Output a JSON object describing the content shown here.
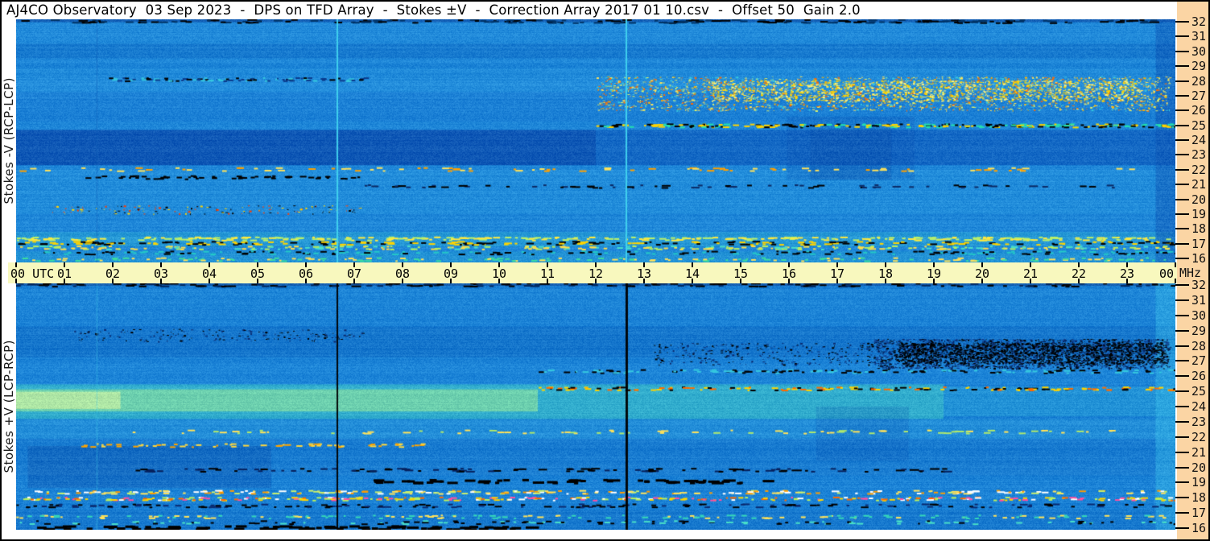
{
  "window": {
    "border_color": "#000000",
    "background": "#ffffff"
  },
  "title_bar": {
    "text": "AJ4CO Observatory  03 Sep 2023  -  DPS on TFD Array  -  Stokes ±V  -  Correction Array 2017 01 10.csv  -  Offset 50  Gain 2.0"
  },
  "time_axis": {
    "background": "#F8F8BE",
    "start_label": "00 UTC",
    "hour_labels": [
      "01",
      "02",
      "03",
      "04",
      "05",
      "06",
      "07",
      "08",
      "09",
      "10",
      "11",
      "12",
      "13",
      "14",
      "15",
      "16",
      "17",
      "18",
      "19",
      "20",
      "21",
      "22",
      "23"
    ],
    "end_label": "00",
    "unit_label": "MHz"
  },
  "freq_axis": {
    "strip_background": "#FBD5A4",
    "labels": [
      "32",
      "31",
      "30",
      "29",
      "28",
      "27",
      "26",
      "25",
      "24",
      "23",
      "22",
      "21",
      "20",
      "19",
      "18",
      "17",
      "16"
    ]
  },
  "panels": [
    {
      "id": "top",
      "side_label": "Stokes -V (RCP-LCP)",
      "render": {
        "seed": 11,
        "base": "#1E86D8",
        "bands": [
          {
            "y0": 0.0,
            "y1": 0.012,
            "color": "#0b3f9a",
            "a": 0.55
          },
          {
            "y0": 0.012,
            "y1": 0.1,
            "color": "#2591de",
            "a": 0.45
          },
          {
            "y0": 0.1,
            "y1": 0.16,
            "color": "#1570c8",
            "a": 0.4
          },
          {
            "y0": 0.2,
            "y1": 0.3,
            "color": "#2d9ce2",
            "a": 0.3
          },
          {
            "y0": 0.3,
            "y1": 0.42,
            "color": "#1a78cf",
            "a": 0.3
          },
          {
            "y0": 0.455,
            "y1": 0.6,
            "color": "#0a4cb2",
            "a": 0.5
          },
          {
            "x0": 0.0,
            "x1": 0.5,
            "y0": 0.455,
            "y1": 0.6,
            "color": "#083f9f",
            "a": 0.4
          },
          {
            "y0": 0.62,
            "y1": 0.8,
            "color": "#2f9fe0",
            "a": 0.3
          },
          {
            "y0": 0.875,
            "y1": 0.935,
            "color": "#31b7d8",
            "a": 0.4
          },
          {
            "y0": 0.955,
            "y1": 1.0,
            "color": "#2ba8d4",
            "a": 0.35
          },
          {
            "x0": 0.665,
            "x1": 0.775,
            "y0": 0.4,
            "y1": 0.66,
            "color": "#0d55b2",
            "a": 0.25
          },
          {
            "x0": 0.685,
            "x1": 0.755,
            "y0": 0.45,
            "y1": 0.66,
            "color": "#0a4aa4",
            "a": 0.25
          },
          {
            "x0": 0.983,
            "x1": 1.0,
            "y0": 0.0,
            "y1": 1.0,
            "color": "#0f57b5",
            "a": 0.5
          }
        ],
        "speckles": [
          {
            "x0": 0.5,
            "x1": 0.995,
            "y0": 0.235,
            "y1": 0.375,
            "colors": [
              "#ffe25a",
              "#ffb300",
              "#d9f06e",
              "#ff6a00",
              "#35c8e0"
            ],
            "n": 2400
          },
          {
            "x0": 0.6,
            "x1": 0.97,
            "y0": 0.25,
            "y1": 0.335,
            "colors": [
              "#ffd400",
              "#fff27a"
            ],
            "n": 1600
          },
          {
            "x0": 0.03,
            "x1": 0.3,
            "y0": 0.765,
            "y1": 0.8,
            "colors": [
              "#000000",
              "#ff3b00",
              "#ffd400"
            ],
            "n": 140
          }
        ],
        "streaks": [
          {
            "y": 0.006,
            "x0": 0,
            "x1": 1,
            "colors": [
              "#003366",
              "#000000"
            ],
            "n": 200,
            "w": 9,
            "h": 2
          },
          {
            "y": 0.245,
            "x0": 0.08,
            "x1": 0.3,
            "colors": [
              "#0a3a8c",
              "#35c8e0",
              "#000000"
            ],
            "n": 90,
            "w": 5,
            "h": 2
          },
          {
            "y": 0.435,
            "x0": 0.5,
            "x1": 1,
            "colors": [
              "#000000",
              "#ffd400",
              "#23e0b0"
            ],
            "n": 260,
            "w": 6,
            "h": 2
          },
          {
            "y": 0.615,
            "x0": 0.0,
            "x1": 1,
            "colors": [
              "#ffe25a",
              "#ffa000"
            ],
            "n": 90,
            "w": 7,
            "h": 2
          },
          {
            "y": 0.648,
            "x0": 0.05,
            "x1": 0.3,
            "colors": [
              "#000000"
            ],
            "n": 55,
            "w": 6,
            "h": 2
          },
          {
            "y": 0.685,
            "x0": 0.3,
            "x1": 0.95,
            "colors": [
              "#0b2a66",
              "#000000"
            ],
            "n": 70,
            "w": 8,
            "h": 2
          },
          {
            "y": 0.9,
            "x0": 0,
            "x1": 1,
            "colors": [
              "#ffe93e",
              "#baf06a"
            ],
            "n": 300,
            "w": 7,
            "h": 2
          },
          {
            "y": 0.918,
            "x0": 0,
            "x1": 1,
            "colors": [
              "#000000",
              "#ffd400"
            ],
            "n": 240,
            "w": 7,
            "h": 2
          },
          {
            "y": 0.937,
            "x0": 0,
            "x1": 1,
            "colors": [
              "#49e0c8",
              "#b8f060",
              "#ffde4a"
            ],
            "n": 280,
            "w": 6,
            "h": 2
          },
          {
            "y": 0.958,
            "x0": 0,
            "x1": 1,
            "colors": [
              "#000000",
              "#24c8c8"
            ],
            "n": 190,
            "w": 6,
            "h": 2
          },
          {
            "y": 0.985,
            "x0": 0,
            "x1": 1,
            "colors": [
              "#3ddca0",
              "#ffe25a"
            ],
            "n": 170,
            "w": 6,
            "h": 2
          }
        ],
        "vlines": [
          {
            "x": 0.0694,
            "w": 1,
            "color": "#0f5cb8",
            "a": 0.55
          },
          {
            "x": 0.2764,
            "w": 2,
            "color": "#41d4ef",
            "a": 0.95
          },
          {
            "x": 0.5257,
            "w": 2,
            "color": "#41d4ef",
            "a": 0.95
          }
        ],
        "noise": 15,
        "rowband": 7
      }
    },
    {
      "id": "bottom",
      "side_label": "Stokes +V (LCP-RCP)",
      "render": {
        "seed": 29,
        "base": "#1B82D6",
        "bands": [
          {
            "y0": 0.0,
            "y1": 0.01,
            "color": "#0a3a8c",
            "a": 0.5
          },
          {
            "y0": 0.03,
            "y1": 0.1,
            "color": "#2590dd",
            "a": 0.35
          },
          {
            "y0": 0.175,
            "y1": 0.3,
            "color": "#0f66c0",
            "a": 0.38
          },
          {
            "y0": 0.33,
            "y1": 0.41,
            "color": "#2590de",
            "a": 0.3
          },
          {
            "x0": 0.0,
            "x1": 0.8,
            "y0": 0.41,
            "y1": 0.55,
            "color": "#46d2c8",
            "a": 0.55
          },
          {
            "x0": 0.0,
            "x1": 0.45,
            "y0": 0.43,
            "y1": 0.52,
            "color": "#9fec96",
            "a": 0.55
          },
          {
            "x0": 0.0,
            "x1": 0.09,
            "y0": 0.44,
            "y1": 0.51,
            "color": "#dcf6a0",
            "a": 0.6
          },
          {
            "x0": 0.8,
            "x1": 1.0,
            "y0": 0.42,
            "y1": 0.54,
            "color": "#35b8dc",
            "a": 0.3
          },
          {
            "y0": 0.55,
            "y1": 0.63,
            "color": "#2fa0de",
            "a": 0.4
          },
          {
            "y0": 0.63,
            "y1": 0.78,
            "color": "#1670c8",
            "a": 0.3
          },
          {
            "x0": 0.01,
            "x1": 0.22,
            "y0": 0.66,
            "y1": 0.83,
            "color": "#0c52ae",
            "a": 0.38
          },
          {
            "x0": 0.69,
            "x1": 0.77,
            "y0": 0.5,
            "y1": 0.72,
            "color": "#0d55b2",
            "a": 0.22
          },
          {
            "y0": 0.92,
            "y1": 1.0,
            "color": "#146cc4",
            "a": 0.35
          },
          {
            "x0": 0.983,
            "x1": 1.0,
            "y0": 0.0,
            "y1": 1.0,
            "color": "#39bce8",
            "a": 0.45
          }
        ],
        "speckles": [
          {
            "x0": 0.74,
            "x1": 0.995,
            "y0": 0.225,
            "y1": 0.345,
            "colors": [
              "#000000",
              "#06215e",
              "#123c8e"
            ],
            "n": 2600
          },
          {
            "x0": 0.76,
            "x1": 0.99,
            "y0": 0.24,
            "y1": 0.325,
            "colors": [
              "#000000"
            ],
            "n": 1600
          },
          {
            "x0": 0.55,
            "x1": 0.74,
            "y0": 0.24,
            "y1": 0.33,
            "colors": [
              "#0a2a70",
              "#000000"
            ],
            "n": 300
          },
          {
            "x0": 0.05,
            "x1": 0.3,
            "y0": 0.185,
            "y1": 0.235,
            "colors": [
              "#000000",
              "#0a2a70"
            ],
            "n": 180
          }
        ],
        "streaks": [
          {
            "y": 0.004,
            "x0": 0,
            "x1": 1,
            "colors": [
              "#00275e",
              "#000000"
            ],
            "n": 190,
            "w": 9,
            "h": 2
          },
          {
            "y": 0.355,
            "x0": 0.45,
            "x1": 1,
            "colors": [
              "#000000",
              "#35c8e0"
            ],
            "n": 140,
            "w": 6,
            "h": 2
          },
          {
            "y": 0.425,
            "x0": 0.45,
            "x1": 1,
            "colors": [
              "#ffd400",
              "#ff6a00",
              "#000000"
            ],
            "n": 160,
            "w": 6,
            "h": 2
          },
          {
            "y": 0.6,
            "x0": 0.1,
            "x1": 0.95,
            "colors": [
              "#ffe25a",
              "#aee86e"
            ],
            "n": 80,
            "w": 7,
            "h": 2
          },
          {
            "y": 0.655,
            "x0": 0.05,
            "x1": 0.35,
            "colors": [
              "#ffd83e",
              "#ffa400"
            ],
            "n": 60,
            "w": 6,
            "h": 2
          },
          {
            "y": 0.755,
            "x0": 0.1,
            "x1": 0.8,
            "colors": [
              "#000000",
              "#06215e"
            ],
            "n": 110,
            "w": 9,
            "h": 2
          },
          {
            "y": 0.8,
            "x0": 0.3,
            "x1": 0.65,
            "colors": [
              "#000000"
            ],
            "n": 55,
            "w": 11,
            "h": 3
          },
          {
            "y": 0.845,
            "x0": 0,
            "x1": 1,
            "colors": [
              "#ffe25a",
              "#ff9d00",
              "#ffffff",
              "#caf06e"
            ],
            "n": 220,
            "w": 7,
            "h": 2
          },
          {
            "y": 0.872,
            "x0": 0,
            "x1": 1,
            "colors": [
              "#ffd400",
              "#ff4fa0",
              "#ffffff",
              "#b8f060",
              "#ff6a00"
            ],
            "n": 300,
            "w": 6,
            "h": 2
          },
          {
            "y": 0.9,
            "x0": 0,
            "x1": 1,
            "colors": [
              "#000000",
              "#0a2a70"
            ],
            "n": 170,
            "w": 7,
            "h": 2
          },
          {
            "y": 0.945,
            "x0": 0,
            "x1": 1,
            "colors": [
              "#35d8b8",
              "#ffe25a"
            ],
            "n": 150,
            "w": 6,
            "h": 2
          },
          {
            "y": 0.968,
            "x0": 0,
            "x1": 1,
            "colors": [
              "#49e0c8",
              "#000000"
            ],
            "n": 130,
            "w": 6,
            "h": 2
          },
          {
            "y": 0.988,
            "x0": 0,
            "x1": 0.45,
            "colors": [
              "#000000"
            ],
            "n": 80,
            "w": 12,
            "h": 3
          }
        ],
        "vlines": [
          {
            "x": 0.0694,
            "w": 1,
            "color": "#45d0ea",
            "a": 0.45
          },
          {
            "x": 0.2764,
            "w": 2,
            "color": "#000000",
            "a": 0.95
          },
          {
            "x": 0.5257,
            "w": 3,
            "color": "#000000",
            "a": 0.95
          }
        ],
        "noise": 15,
        "rowband": 7
      }
    }
  ],
  "chart_data": {
    "type": "heatmap",
    "title": "AJ4CO Observatory 03 Sep 2023 - DPS on TFD Array - Stokes ±V - Correction Array 2017 01 10.csv - Offset 50 Gain 2.0",
    "x_axis": {
      "label": "UTC",
      "range_hours": [
        0,
        24
      ],
      "tick_labels": [
        "00",
        "01",
        "02",
        "03",
        "04",
        "05",
        "06",
        "07",
        "08",
        "09",
        "10",
        "11",
        "12",
        "13",
        "14",
        "15",
        "16",
        "17",
        "18",
        "19",
        "20",
        "21",
        "22",
        "23",
        "00"
      ]
    },
    "y_axis": {
      "label": "MHz",
      "range_mhz": [
        16,
        32
      ],
      "tick_labels": [
        32,
        31,
        30,
        29,
        28,
        27,
        26,
        25,
        24,
        23,
        22,
        21,
        20,
        19,
        18,
        17,
        16
      ]
    },
    "grid": false,
    "legend_position": "none",
    "colormap": "intensity: dark blue → blue → cyan → green → yellow → red",
    "panels": [
      {
        "name": "Stokes -V (RCP-LCP)",
        "features": [
          "Dark horizontal band ~23-25 MHz strongest from 00:00 to ~12:30 UTC",
          "Bright cyan vertical calibration lines at ~06:38 and ~12:37 UTC",
          "Dense yellow/orange speckle emission 26-28 MHz after ~12:30 UTC, heaviest 18:00-24:00",
          "Mixed black/yellow RFI dash row near 25 MHz after 12:30 UTC",
          "Strong yellow-green RFI streak rows 16.5-18 MHz across the full day",
          "Darker blue column at far right edge (~23:50-24:00 UTC)"
        ]
      },
      {
        "name": "Stokes +V (LCP-RCP)",
        "features": [
          "Bright cyan-green emission band ~23-24.5 MHz, brightest 00:00-08:00 UTC",
          "Black vertical dropout lines at ~06:38 and ~12:37 UTC",
          "Dark/black speckle absorption patch 26.5-28 MHz from ~17:45 to ~23:50 UTC",
          "Colorful RFI streak rows (yellow/white/magenta) 16.5-18.5 MHz across the full day",
          "Dark region ~18.5-20.5 MHz near 00:30-05:00 UTC",
          "Lighter cyan column at far right edge (~23:50-24:00 UTC)"
        ]
      }
    ]
  }
}
